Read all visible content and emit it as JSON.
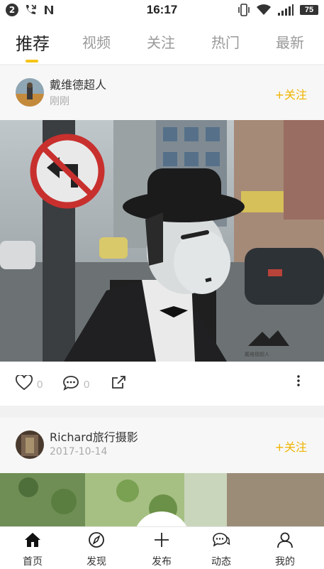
{
  "status_bar": {
    "notification_count": "2",
    "time": "16:17",
    "battery": "75"
  },
  "tabs": [
    {
      "label": "推荐",
      "active": true
    },
    {
      "label": "视频",
      "active": false
    },
    {
      "label": "关注",
      "active": false
    },
    {
      "label": "热门",
      "active": false
    },
    {
      "label": "最新",
      "active": false
    }
  ],
  "posts": [
    {
      "username": "戴维德超人",
      "time": "刚刚",
      "follow_label": "+关注",
      "likes": "0",
      "comments": "0",
      "watermark": "戴维德超人"
    },
    {
      "username": "Richard旅行摄影",
      "time": "2017-10-14",
      "follow_label": "+关注"
    }
  ],
  "bottom_nav": [
    {
      "label": "首页",
      "icon": "home-icon"
    },
    {
      "label": "发现",
      "icon": "compass-icon"
    },
    {
      "label": "发布",
      "icon": "plus-icon"
    },
    {
      "label": "动态",
      "icon": "chat-bubbles-icon"
    },
    {
      "label": "我的",
      "icon": "person-icon"
    }
  ],
  "colors": {
    "accent": "#f5c518",
    "follow": "#f0b400"
  }
}
